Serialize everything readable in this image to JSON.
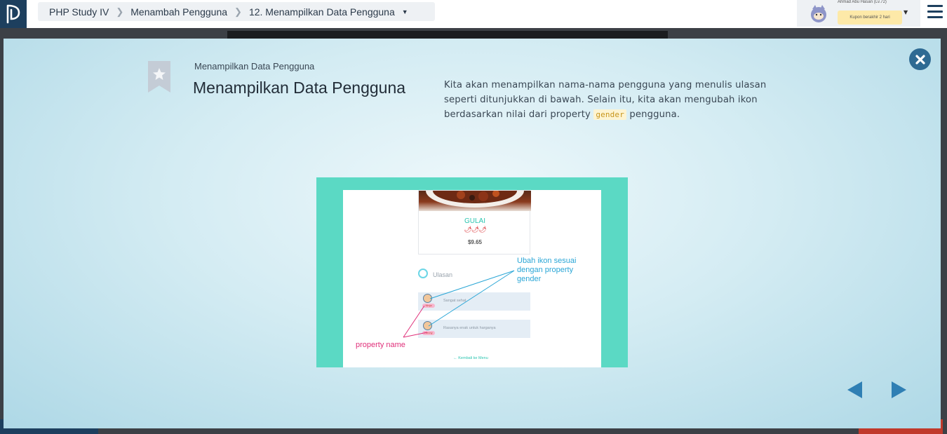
{
  "breadcrumb": {
    "course": "PHP Study IV",
    "chapter": "Menambah Pengguna",
    "lesson": "12. Menampilkan Data Pengguna"
  },
  "user": {
    "name": "Ahmad Abu Hasan (Lv.72)",
    "coupon": "Kupon berakhir 2 hari"
  },
  "slide": {
    "subtitle": "Menampilkan Data Pengguna",
    "title": "Menampilkan Data Pengguna",
    "desc_part1": "Kita akan menampilkan nama-nama pengguna yang menulis ulasan seperti ditunjukkan di bawah. Selain itu, kita akan mengubah ikon berdasarkan nilai dari property ",
    "desc_code": "gender",
    "desc_part2": " pengguna."
  },
  "illustration": {
    "food_name": "GULAI",
    "chili": "🌶🌶🌶",
    "price": "$9.65",
    "reviews_label": "Ulasan",
    "review_1_name": "Ninja",
    "review_1_text": "Sangat sehat",
    "review_2_name": "Kenny",
    "review_2_text": "Rasanya enak untuk harganya",
    "back_link": "← Kembali ke Menu",
    "annot_blue_line1": "Ubah ikon sesuai",
    "annot_blue_line2": "dengan property",
    "annot_blue_line3": "gender",
    "annot_pink": "property name"
  },
  "colors": {
    "accent": "#2e6a93",
    "teal": "#5bd9c4",
    "annotation_blue": "#2aa6d6",
    "annotation_pink": "#e0307a"
  }
}
